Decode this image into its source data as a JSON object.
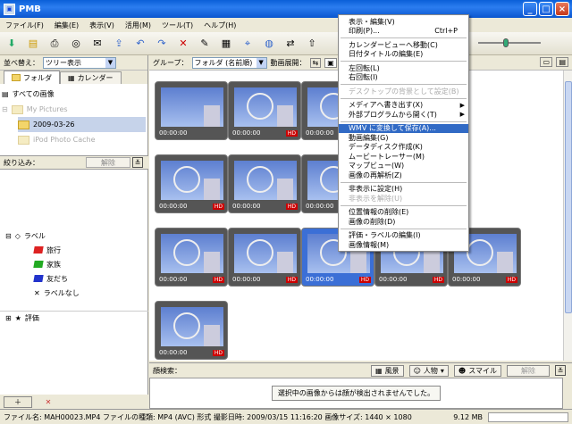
{
  "window": {
    "title": "PMB"
  },
  "menu": [
    "ファイル(F)",
    "編集(E)",
    "表示(V)",
    "活用(M)",
    "ツール(T)",
    "ヘルプ(H)"
  ],
  "sort": {
    "label": "並べ替え：",
    "value": "ツリー表示"
  },
  "tabs": {
    "folder": "フォルダ",
    "calendar": "カレンダー"
  },
  "tree": {
    "all_images": "すべての画像",
    "my_pictures": "My Pictures",
    "date_folder": "2009-03-26",
    "ipod": "iPod Photo Cache"
  },
  "filter": {
    "label": "絞り込み：",
    "clear": "解除"
  },
  "labels": {
    "header": "ラベル",
    "items": [
      "旅行",
      "家族",
      "友だち",
      "ラベルなし"
    ],
    "rating": "評価"
  },
  "group": {
    "label": "グループ：",
    "value": "フォルダ (名前順)",
    "video_expand": "動画展開："
  },
  "thumbnails": [
    {
      "time": "00:00:00",
      "hd": "HD"
    },
    {
      "time": "00:00:00",
      "hd": "HD"
    },
    {
      "time": "00:00:00",
      "hd": "HD"
    },
    {
      "time": "00:00:00",
      "hd": "HD"
    },
    {
      "time": "00:00:00",
      "hd": "HD"
    },
    {
      "time": "00:00:00",
      "hd": "HD"
    },
    {
      "time": "00:00:00",
      "hd": "HD"
    },
    {
      "time": "00:00:00",
      "hd": "HD"
    },
    {
      "time": "00:00:00",
      "hd": "HD"
    },
    {
      "time": "00:00:00",
      "hd": "HD"
    },
    {
      "time": "00:00:00",
      "hd": "HD"
    },
    {
      "time": "00:00:00",
      "hd": "HD"
    },
    {
      "time": "00:00:00",
      "hd": "HD"
    }
  ],
  "face_search": {
    "label": "顔検索：",
    "landscape": "風景",
    "person": "人物",
    "smile": "スマイル",
    "clear": "解除",
    "result": "選択中の画像からは顔が検出されませんでした。"
  },
  "context_menu": {
    "items": [
      {
        "label": "表示・編集(V)",
        "state": "normal"
      },
      {
        "label": "印刷(P)...",
        "shortcut": "Ctrl+P",
        "state": "normal"
      },
      {
        "sep": true
      },
      {
        "label": "カレンダービューへ移動(C)",
        "state": "normal"
      },
      {
        "label": "日付タイトルの編集(E)",
        "state": "normal"
      },
      {
        "sep": true
      },
      {
        "label": "左回転(L)",
        "state": "normal"
      },
      {
        "label": "右回転(I)",
        "state": "normal"
      },
      {
        "sep": true
      },
      {
        "label": "デスクトップの背景として設定(B)",
        "state": "disabled"
      },
      {
        "sep": true
      },
      {
        "label": "メディアへ書き出す(X)",
        "state": "normal",
        "submenu": true
      },
      {
        "label": "外部プログラムから開く(T)",
        "state": "normal",
        "submenu": true
      },
      {
        "sep": true
      },
      {
        "label": "WMV に変換して保存(A)...",
        "state": "highlight"
      },
      {
        "label": "動画編集(G)",
        "state": "normal"
      },
      {
        "label": "データディスク作成(K)",
        "state": "normal"
      },
      {
        "label": "ムービートレーサー(M)",
        "state": "normal"
      },
      {
        "label": "マップビュー(W)",
        "state": "normal"
      },
      {
        "label": "画像の再解析(Z)",
        "state": "normal"
      },
      {
        "sep": true
      },
      {
        "label": "非表示に設定(H)",
        "state": "normal"
      },
      {
        "label": "非表示を解除(U)",
        "state": "disabled"
      },
      {
        "sep": true
      },
      {
        "label": "位置情報の削除(E)",
        "state": "normal"
      },
      {
        "label": "画像の削除(D)",
        "state": "normal"
      },
      {
        "sep": true
      },
      {
        "label": "評価・ラベルの編集(I)",
        "state": "normal"
      },
      {
        "label": "画像情報(M)",
        "state": "normal"
      }
    ]
  },
  "status": {
    "info": "ファイル名: MAH00023.MP4  ファイルの種類: MP4 (AVC) 形式  撮影日時: 2009/03/15 11:16:20  画像サイズ: 1440 × 1080",
    "size": "9.12 MB"
  },
  "colors": {
    "title": "#0b56cf",
    "selection": "#316ac5",
    "hd_badge": "#cc0000"
  }
}
